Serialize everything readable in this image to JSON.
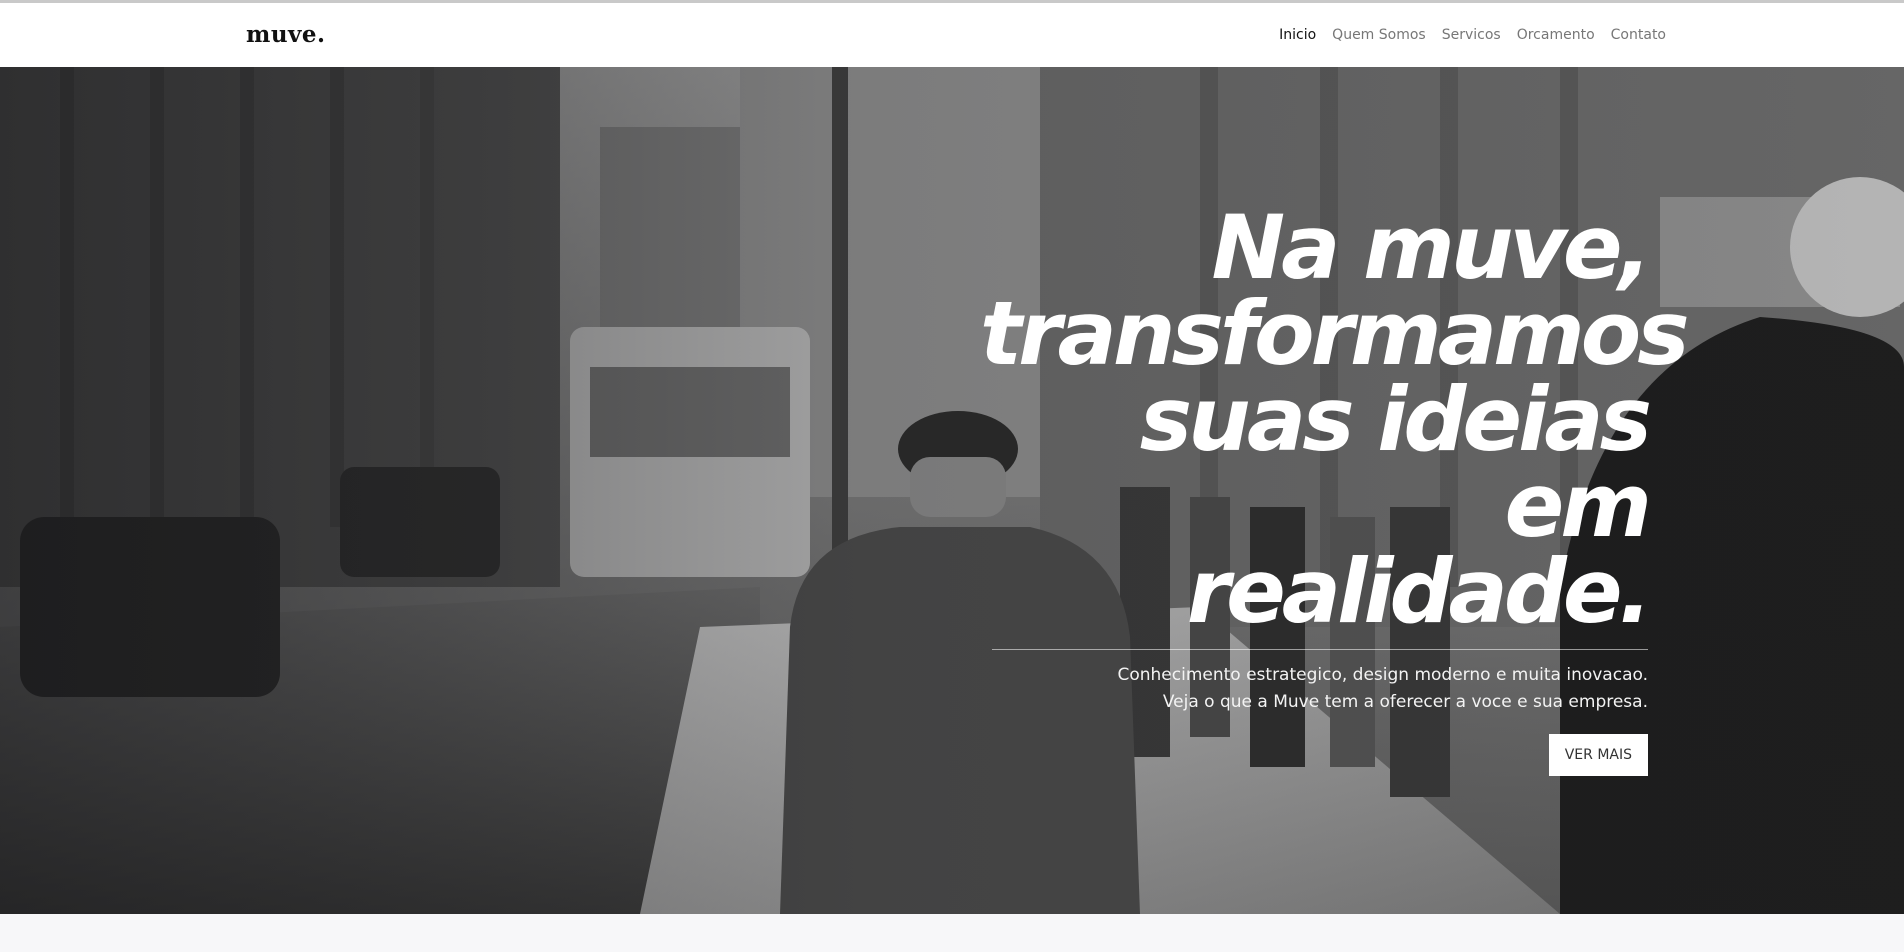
{
  "brand": {
    "logo": "muve."
  },
  "nav": {
    "items": [
      {
        "label": "Inicio",
        "active": true
      },
      {
        "label": "Quem Somos",
        "active": false
      },
      {
        "label": "Servicos",
        "active": false
      },
      {
        "label": "Orcamento",
        "active": false
      },
      {
        "label": "Contato",
        "active": false
      }
    ]
  },
  "hero": {
    "headline_lines": [
      "Na muve,",
      "transformamos",
      "suas ideias em",
      "realidade."
    ],
    "subtitle_lines": [
      "Conhecimento estrategico, design moderno e muita inovacao.",
      "Veja o que a Muve tem a oferecer a voce e sua empresa."
    ],
    "cta_label": "VER MAIS",
    "background_image": "black-and-white-city-street-photo"
  },
  "colors": {
    "nav_bg": "#ffffff",
    "nav_text": "#777777",
    "nav_active": "#111111",
    "hero_text": "#ffffff",
    "button_bg": "#ffffff",
    "button_text": "#333333"
  }
}
